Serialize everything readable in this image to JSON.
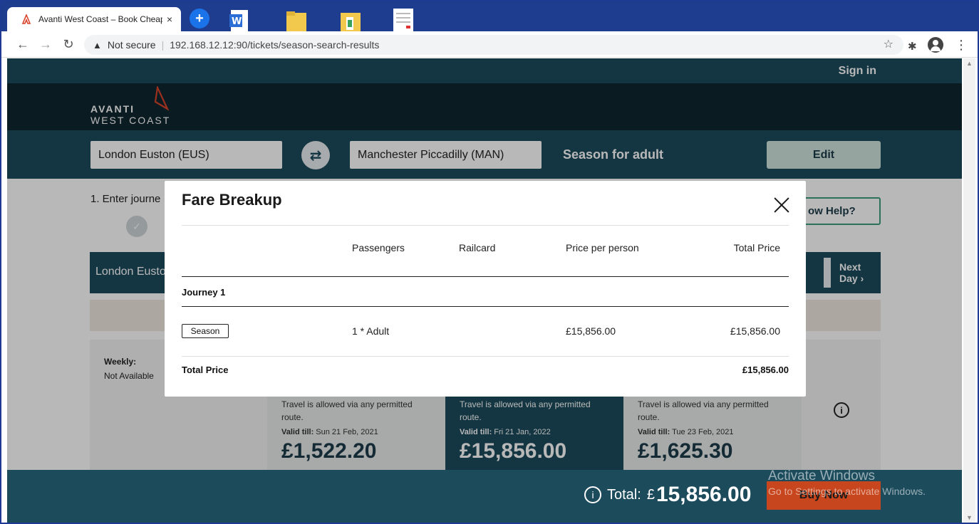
{
  "browser": {
    "tab_title": "Avanti West Coast – Book Cheap",
    "tab_close": "×",
    "new_tab": "+",
    "not_secure": "Not secure",
    "url": "192.168.12.12:90/tickets/season-search-results"
  },
  "site": {
    "sign_in": "Sign in",
    "logo_line1": "AVANTI",
    "logo_line2": "WEST COAST"
  },
  "search": {
    "from": "London Euston (EUS)",
    "to": "Manchester Piccadilly (MAN)",
    "swap_glyph": "⇄",
    "ticket_type": "Season for adult",
    "edit_label": "Edit"
  },
  "content": {
    "step_label": "1. Enter journe",
    "help_label": "ow Help?",
    "route_from": "London Eusto",
    "next_day": "Next Day ›",
    "weekly_title": "Weekly:",
    "weekly_status": "Not Available",
    "cards": [
      {
        "note": "Travel is allowed via any permitted route.",
        "valid_label": "Valid till:",
        "valid_date": "Sun 21 Feb, 2021",
        "price": "£1,522.20"
      },
      {
        "note": "Travel is allowed via any permitted route.",
        "valid_label": "Valid till:",
        "valid_date": "Fri 21 Jan, 2022",
        "price": "£15,856.00"
      },
      {
        "note": "Travel is allowed via any permitted route.",
        "valid_label": "Valid till:",
        "valid_date": "Tue 23 Feb, 2021",
        "price": "£1,625.30"
      }
    ]
  },
  "modal": {
    "title": "Fare Breakup",
    "headers": {
      "passengers": "Passengers",
      "railcard": "Railcard",
      "price_per_person": "Price per person",
      "total_price": "Total Price"
    },
    "journey_label": "Journey 1",
    "row": {
      "ticket": "Season",
      "passengers": "1 * Adult",
      "railcard": "",
      "price_per_person": "£15,856.00",
      "total_price": "£15,856.00"
    },
    "total_label": "Total Price",
    "total_value": "£15,856.00"
  },
  "footer": {
    "total_label": "Total:",
    "currency": "£",
    "total_amount": "15,856.00",
    "buy_now": "Buy Now",
    "watermark_title": "Activate Windows",
    "watermark_sub": "Go to Settings to activate Windows."
  },
  "colors": {
    "brand_teal": "#1c4b5c",
    "brand_dark": "#0f2630",
    "accent_orange": "#c8461d",
    "edit_green": "#cfe3dc"
  }
}
